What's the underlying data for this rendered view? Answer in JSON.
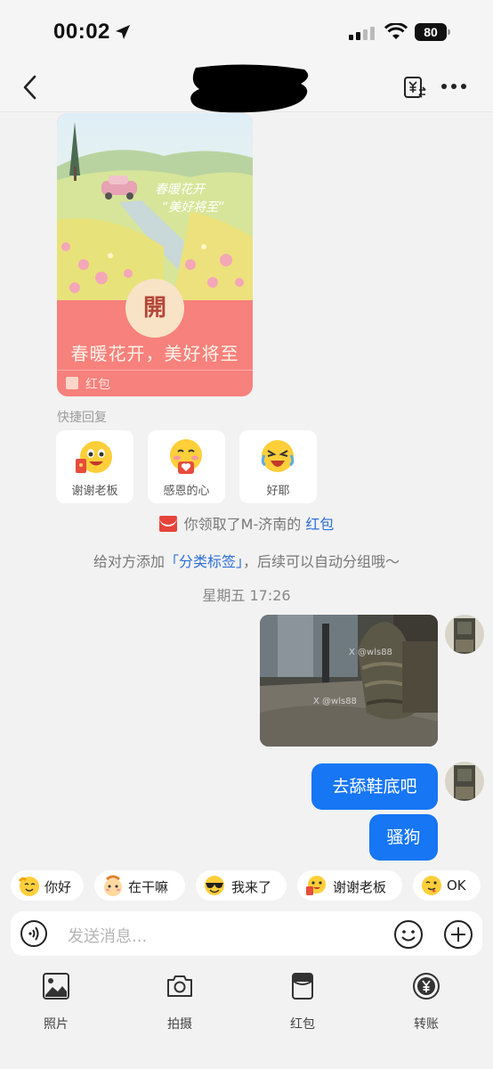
{
  "status_bar": {
    "time": "00:02",
    "battery": "80"
  },
  "nav": {
    "title": ""
  },
  "red_packet": {
    "open_char": "開",
    "wish": "春暖花开，美好将至",
    "footer_label": "红包"
  },
  "quick_reply": {
    "title": "快捷回复",
    "items": [
      {
        "label": "谢谢老板"
      },
      {
        "label": "感恩的心"
      },
      {
        "label": "好耶"
      }
    ]
  },
  "system_messages": {
    "received_prefix": "你领取了M-济南的",
    "received_link": "红包",
    "tag_prefix": "给对方添加",
    "tag_link": "「分类标签」",
    "tag_suffix": "，后续可以自动分组哦～"
  },
  "timestamp": "星期五 17:26",
  "messages": [
    {
      "type": "image",
      "watermark": "X @wls88"
    },
    {
      "type": "text",
      "text": "去舔鞋底吧"
    },
    {
      "type": "text",
      "text": "骚狗"
    }
  ],
  "emoji_chips": [
    {
      "label": "你好",
      "icon": "hello-emoji-icon"
    },
    {
      "label": "在干嘛",
      "icon": "what-doing-emoji-icon"
    },
    {
      "label": "我来了",
      "icon": "sunglasses-emoji-icon"
    },
    {
      "label": "谢谢老板",
      "icon": "thanks-boss-emoji-icon"
    },
    {
      "label": "OK",
      "icon": "ok-emoji-icon"
    }
  ],
  "input": {
    "placeholder": "发送消息..."
  },
  "toolbar": [
    {
      "label": "照片",
      "icon": "photo-icon"
    },
    {
      "label": "拍摄",
      "icon": "camera-icon"
    },
    {
      "label": "红包",
      "icon": "red-packet-icon"
    },
    {
      "label": "转账",
      "icon": "transfer-icon"
    }
  ],
  "colors": {
    "accent_blue": "#1676f3",
    "link_blue": "#2f6fd6",
    "red_packet": "#f7817c",
    "background": "#f2f2f2"
  }
}
